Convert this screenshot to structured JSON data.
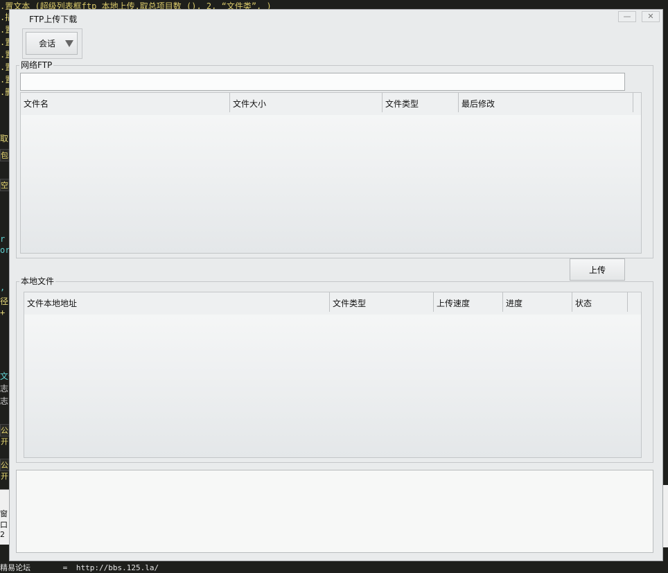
{
  "background": {
    "top_code": ".置文本 (超级列表框ftp_本地上传.取总项目数 (), 2, “文件类”, )",
    "side_lines": [
      ".插",
      ".置",
      ".置",
      ".置",
      ".置",
      ".置",
      ".删"
    ],
    "side_mid": [
      "取",
      "包",
      "空"
    ],
    "side_cyan": [
      "r",
      "ord"
    ],
    "side_lower": [
      ", (",
      "径",
      "+"
    ],
    "side_bottom": [
      "文件",
      "志",
      "志"
    ],
    "side_pub": [
      "公开",
      "公开"
    ],
    "side_window": [
      "窗口",
      "2"
    ],
    "footer_label": "精易论坛",
    "footer_eq": "=",
    "footer_url": "http://bbs.125.la/"
  },
  "window": {
    "title": "FTP上传下载",
    "minimize_glyph": "—",
    "close_glyph": "✕"
  },
  "session": {
    "label": "会话"
  },
  "remote": {
    "group_label": "网络FTP",
    "path_value": "",
    "columns": [
      "文件名",
      "文件大小",
      "文件类型",
      "最后修改"
    ]
  },
  "upload_button": "上传",
  "local": {
    "group_label": "本地文件",
    "columns": [
      "文件本地地址",
      "文件类型",
      "上传速度",
      "进度",
      "状态"
    ]
  },
  "log": {
    "text": ""
  }
}
